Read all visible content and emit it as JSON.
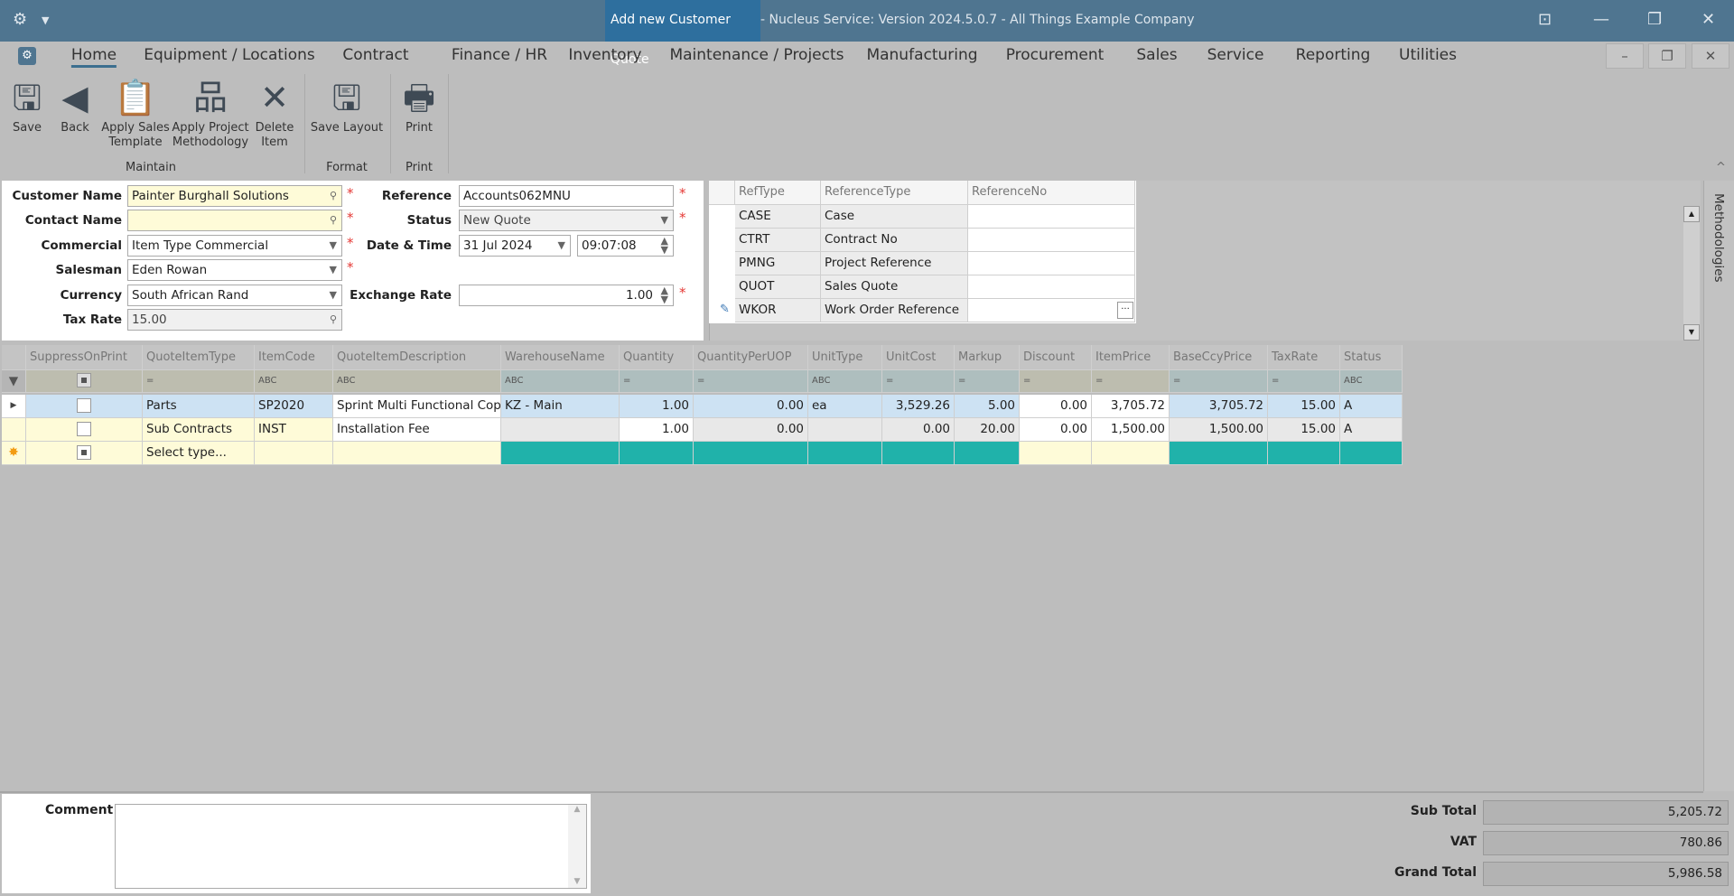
{
  "titlebar": {
    "title_main": "Add new Customer Quote",
    "title_rest": " - Nucleus Service: Version 2024.5.0.7 - All Things Example Company"
  },
  "menu": {
    "tabs": [
      "Home",
      "Equipment / Locations",
      "Contract",
      "Finance / HR",
      "Inventory",
      "Maintenance / Projects",
      "Manufacturing",
      "Procurement",
      "Sales",
      "Service",
      "Reporting",
      "Utilities"
    ]
  },
  "ribbon": {
    "buttons": [
      {
        "l1": "Save",
        "l2": ""
      },
      {
        "l1": "Back",
        "l2": ""
      },
      {
        "l1": "Apply Sales",
        "l2": "Template"
      },
      {
        "l1": "Apply Project",
        "l2": "Methodology"
      },
      {
        "l1": "Delete",
        "l2": "Item"
      },
      {
        "l1": "Save Layout",
        "l2": ""
      },
      {
        "l1": "Print",
        "l2": ""
      }
    ],
    "groups": [
      "Maintain",
      "Format",
      "Print"
    ]
  },
  "form": {
    "customer_name_label": "Customer Name",
    "customer_name": "Painter Burghall Solutions",
    "contact_name_label": "Contact Name",
    "contact_name": "",
    "commercial_label": "Commercial",
    "commercial": "Item Type Commercial",
    "salesman_label": "Salesman",
    "salesman": "Eden Rowan",
    "currency_label": "Currency",
    "currency": "South African Rand",
    "tax_rate_label": "Tax Rate",
    "tax_rate": "15.00",
    "reference_label": "Reference",
    "reference": "Accounts062MNU",
    "status_label": "Status",
    "status": "New Quote",
    "datetime_label": "Date & Time",
    "date": "31 Jul 2024",
    "time": "09:07:08",
    "exchange_rate_label": "Exchange Rate",
    "exchange_rate": "1.00"
  },
  "refgrid": {
    "headers": [
      "RefType",
      "ReferenceType",
      "ReferenceNo"
    ],
    "rows": [
      [
        "CASE",
        "Case",
        ""
      ],
      [
        "CTRT",
        "Contract No",
        ""
      ],
      [
        "PMNG",
        "Project Reference",
        ""
      ],
      [
        "QUOT",
        "Sales Quote",
        ""
      ],
      [
        "WKOR",
        "Work Order Reference",
        ""
      ]
    ]
  },
  "side_tab": "Methodologies",
  "grid": {
    "headers": [
      "SuppressOnPrint",
      "QuoteItemType",
      "ItemCode",
      "QuoteItemDescription",
      "WarehouseName",
      "Quantity",
      "QuantityPerUOP",
      "UnitType",
      "UnitCost",
      "Markup",
      "Discount",
      "ItemPrice",
      "BaseCcyPrice",
      "TaxRate",
      "Status"
    ],
    "rows": [
      [
        "",
        "Parts",
        "SP2020",
        "Sprint Multi Functional Copier",
        "KZ - Main",
        "1.00",
        "0.00",
        "ea",
        "3,529.26",
        "5.00",
        "0.00",
        "3,705.72",
        "3,705.72",
        "15.00",
        "A"
      ],
      [
        "",
        "Sub Contracts",
        "INST",
        "Installation Fee",
        "",
        "1.00",
        "0.00",
        "",
        "0.00",
        "20.00",
        "0.00",
        "1,500.00",
        "1,500.00",
        "15.00",
        "A"
      ],
      [
        "",
        "Select type...",
        "",
        "",
        "",
        "",
        "",
        "",
        "",
        "",
        "",
        "",
        "",
        "",
        ""
      ]
    ]
  },
  "comment": {
    "label": "Comment",
    "value": ""
  },
  "totals": {
    "sub_total_label": "Sub Total",
    "sub_total": "5,205.72",
    "vat_label": "VAT",
    "vat": "780.86",
    "grand_total_label": "Grand Total",
    "grand_total": "5,986.58"
  }
}
